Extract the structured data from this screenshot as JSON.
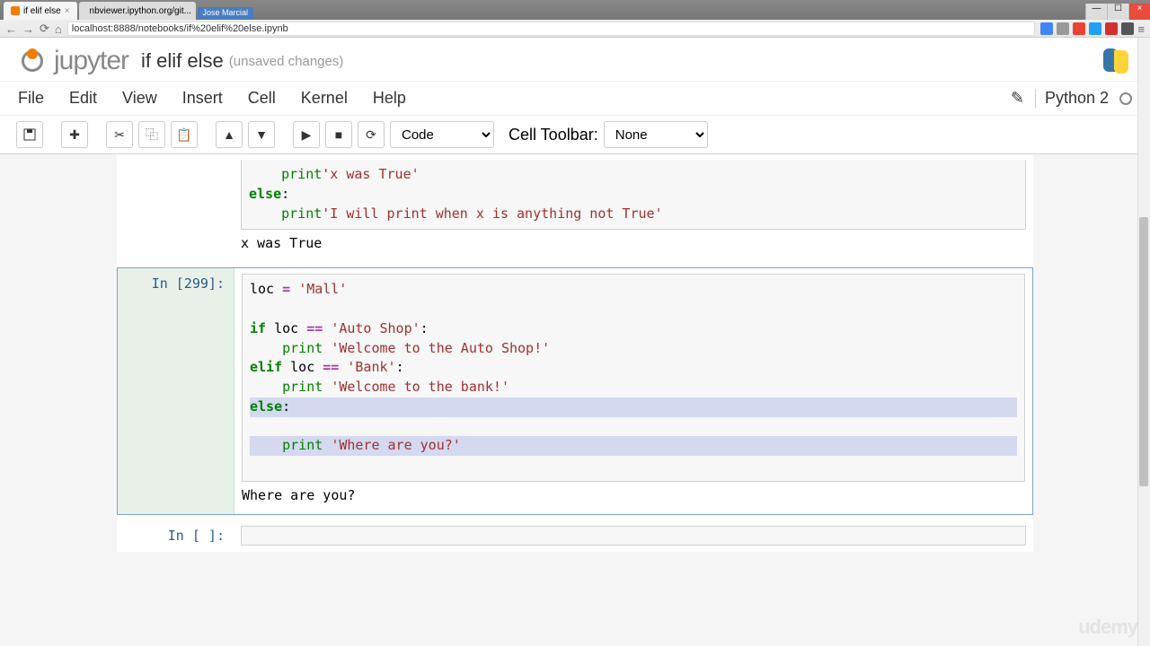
{
  "browser": {
    "tabs": [
      {
        "title": "if elif else",
        "active": true
      },
      {
        "title": "nbviewer.ipython.org/git...",
        "active": false
      }
    ],
    "user_badge": "Jose Marcial",
    "url": "localhost:8888/notebooks/if%20elif%20else.ipynb"
  },
  "header": {
    "logo_text": "jupyter",
    "notebook_title": "if elif else",
    "status": "(unsaved changes)"
  },
  "menu": {
    "items": [
      "File",
      "Edit",
      "View",
      "Insert",
      "Cell",
      "Kernel",
      "Help"
    ],
    "kernel": "Python 2"
  },
  "toolbar": {
    "celltype_selected": "Code",
    "cell_toolbar_label": "Cell Toolbar:",
    "cell_toolbar_selected": "None"
  },
  "cells": {
    "partial_top": {
      "code_lines": [
        {
          "indent": 1,
          "tokens": [
            [
              "builtin",
              "print"
            ],
            [
              "",
              ""
            ],
            [
              "str",
              "'x was True'"
            ]
          ]
        },
        {
          "indent": 0,
          "tokens": [
            [
              "kw",
              "else"
            ],
            [
              "",
              ":"
            ]
          ]
        },
        {
          "indent": 1,
          "tokens": [
            [
              "builtin",
              "print"
            ],
            [
              "",
              ""
            ],
            [
              "str",
              "'I will print when x is anything not True'"
            ]
          ]
        }
      ],
      "output": "x was True"
    },
    "loc_cell": {
      "prompt": "In [299]:",
      "code_lines": [
        {
          "indent": 0,
          "hl": false,
          "tokens": [
            [
              "",
              "loc "
            ],
            [
              "op",
              "="
            ],
            [
              "",
              " "
            ],
            [
              "str",
              "'Mall'"
            ]
          ]
        },
        {
          "indent": 0,
          "hl": false,
          "tokens": [
            [
              "",
              ""
            ]
          ]
        },
        {
          "indent": 0,
          "hl": false,
          "tokens": [
            [
              "kw",
              "if"
            ],
            [
              "",
              " loc "
            ],
            [
              "op",
              "=="
            ],
            [
              "",
              " "
            ],
            [
              "str",
              "'Auto Shop'"
            ],
            [
              "",
              ":"
            ]
          ]
        },
        {
          "indent": 1,
          "hl": false,
          "tokens": [
            [
              "builtin",
              "print"
            ],
            [
              "",
              " "
            ],
            [
              "str",
              "'Welcome to the Auto Shop!'"
            ]
          ]
        },
        {
          "indent": 0,
          "hl": false,
          "tokens": [
            [
              "kw",
              "elif"
            ],
            [
              "",
              " loc "
            ],
            [
              "op",
              "=="
            ],
            [
              "",
              " "
            ],
            [
              "str",
              "'Bank'"
            ],
            [
              "",
              ":"
            ]
          ]
        },
        {
          "indent": 1,
          "hl": false,
          "tokens": [
            [
              "builtin",
              "print"
            ],
            [
              "",
              " "
            ],
            [
              "str",
              "'Welcome to the bank!'"
            ]
          ]
        },
        {
          "indent": 0,
          "hl": true,
          "tokens": [
            [
              "kw",
              "else"
            ],
            [
              "",
              ":"
            ]
          ]
        },
        {
          "indent": 1,
          "hl": true,
          "tokens": [
            [
              "builtin",
              "print"
            ],
            [
              "",
              " "
            ],
            [
              "str",
              "'Where are you?'"
            ]
          ]
        }
      ],
      "output": "Where are you?"
    },
    "empty_cell": {
      "prompt": "In [ ]:"
    }
  },
  "watermark": "udemy"
}
